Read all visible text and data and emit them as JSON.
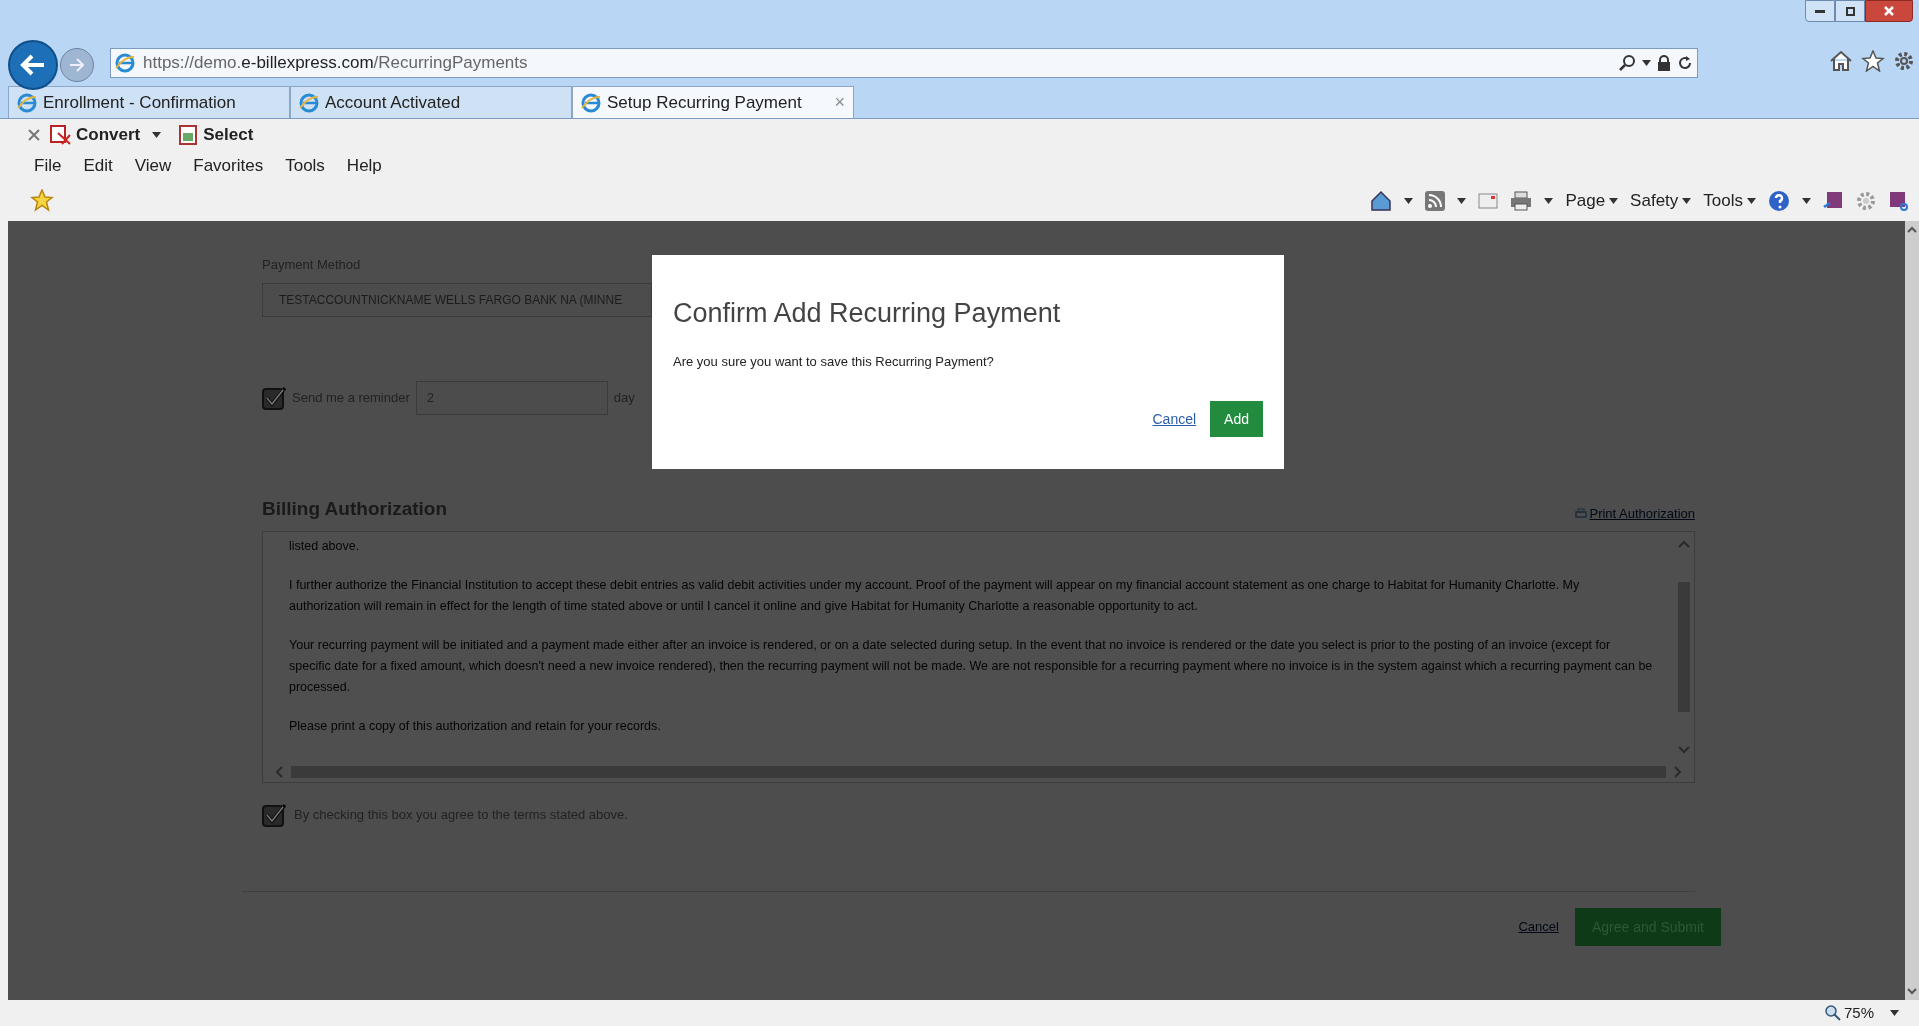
{
  "browser": {
    "address": {
      "scheme": "https://",
      "host_prefix": "demo.",
      "host": "e-billexpress.com",
      "path": "/RecurringPayments"
    },
    "tabs": [
      {
        "label": "Enrollment - Confirmation",
        "selected": false
      },
      {
        "label": "Account Activated",
        "selected": false
      },
      {
        "label": "Setup Recurring Payment",
        "selected": true,
        "close": "×"
      }
    ],
    "command_bar": {
      "convert": "Convert",
      "select": "Select"
    },
    "menu": [
      "File",
      "Edit",
      "View",
      "Favorites",
      "Tools",
      "Help"
    ],
    "toolbar": [
      "Page",
      "Safety",
      "Tools"
    ],
    "zoom": "75%"
  },
  "page": {
    "payment_method": {
      "label": "Payment Method",
      "value": "TESTACCOUNTNICKNAME WELLS FARGO BANK NA (MINNE"
    },
    "reminder": {
      "checked": true,
      "label": "Send me a reminder",
      "value": "2",
      "unit": "day"
    },
    "billing": {
      "title": "Billing Authorization",
      "print_link": "Print Authorization",
      "paragraphs": [
        "listed above.",
        "I further authorize the Financial Institution to accept these debit entries as valid debit activities under my account. Proof of the payment will appear on my financial account statement as one charge to Habitat for Humanity Charlotte. My authorization will remain in effect for the length of time stated above or until I cancel it online and give Habitat for Humanity Charlotte a reasonable opportunity to act.",
        "Your recurring payment will be initiated and a payment made either after an invoice is rendered, or on a date selected during setup. In the event that no invoice is rendered or the date you select is prior to the posting of an invoice (except for specific date for a fixed amount, which doesn't need a new invoice rendered), then the recurring payment will not be made. We are not responsible for a recurring payment where no invoice is in the system against which a recurring payment can be processed.",
        "Please print a copy of this authorization and retain for your records."
      ]
    },
    "agree": {
      "checked": true,
      "label": "By checking this box you agree to the terms stated above."
    },
    "cancel": "Cancel",
    "submit": "Agree and Submit"
  },
  "dialog": {
    "title": "Confirm Add Recurring Payment",
    "message": "Are you sure you want to save this Recurring Payment?",
    "cancel": "Cancel",
    "confirm": "Add"
  }
}
